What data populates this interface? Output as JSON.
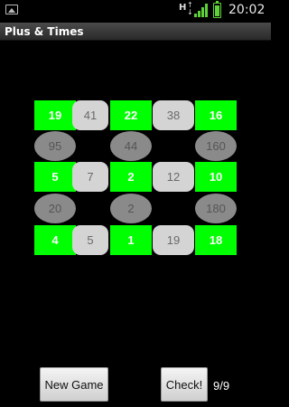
{
  "status_bar": {
    "network_label": "H",
    "time": "20:02"
  },
  "app": {
    "title": "Plus & Times"
  },
  "board": {
    "rows": [
      {
        "kind": "number",
        "cells": [
          {
            "value": "19",
            "style": "green"
          },
          {
            "value": "41",
            "style": "pill"
          },
          {
            "value": "22",
            "style": "green"
          },
          {
            "value": "38",
            "style": "pill"
          },
          {
            "value": "16",
            "style": "green"
          }
        ]
      },
      {
        "kind": "product",
        "cells": [
          {
            "value": "95",
            "style": "oval"
          },
          {
            "value": "44",
            "style": "oval"
          },
          {
            "value": "160",
            "style": "oval"
          }
        ]
      },
      {
        "kind": "number",
        "cells": [
          {
            "value": "5",
            "style": "green"
          },
          {
            "value": "7",
            "style": "pill"
          },
          {
            "value": "2",
            "style": "green"
          },
          {
            "value": "12",
            "style": "pill"
          },
          {
            "value": "10",
            "style": "green"
          }
        ]
      },
      {
        "kind": "product",
        "cells": [
          {
            "value": "20",
            "style": "oval"
          },
          {
            "value": "2",
            "style": "oval"
          },
          {
            "value": "180",
            "style": "oval"
          }
        ]
      },
      {
        "kind": "number",
        "cells": [
          {
            "value": "4",
            "style": "green"
          },
          {
            "value": "5",
            "style": "pill"
          },
          {
            "value": "1",
            "style": "green"
          },
          {
            "value": "19",
            "style": "pill"
          },
          {
            "value": "18",
            "style": "green"
          }
        ]
      }
    ]
  },
  "controls": {
    "new_game_label": "New Game",
    "check_label": "Check!",
    "score": "9/9"
  },
  "colors": {
    "accent_green": "#00ff00",
    "pill_gray": "#d4d4d4",
    "oval_gray": "#8a8a8a",
    "background": "#000000"
  }
}
